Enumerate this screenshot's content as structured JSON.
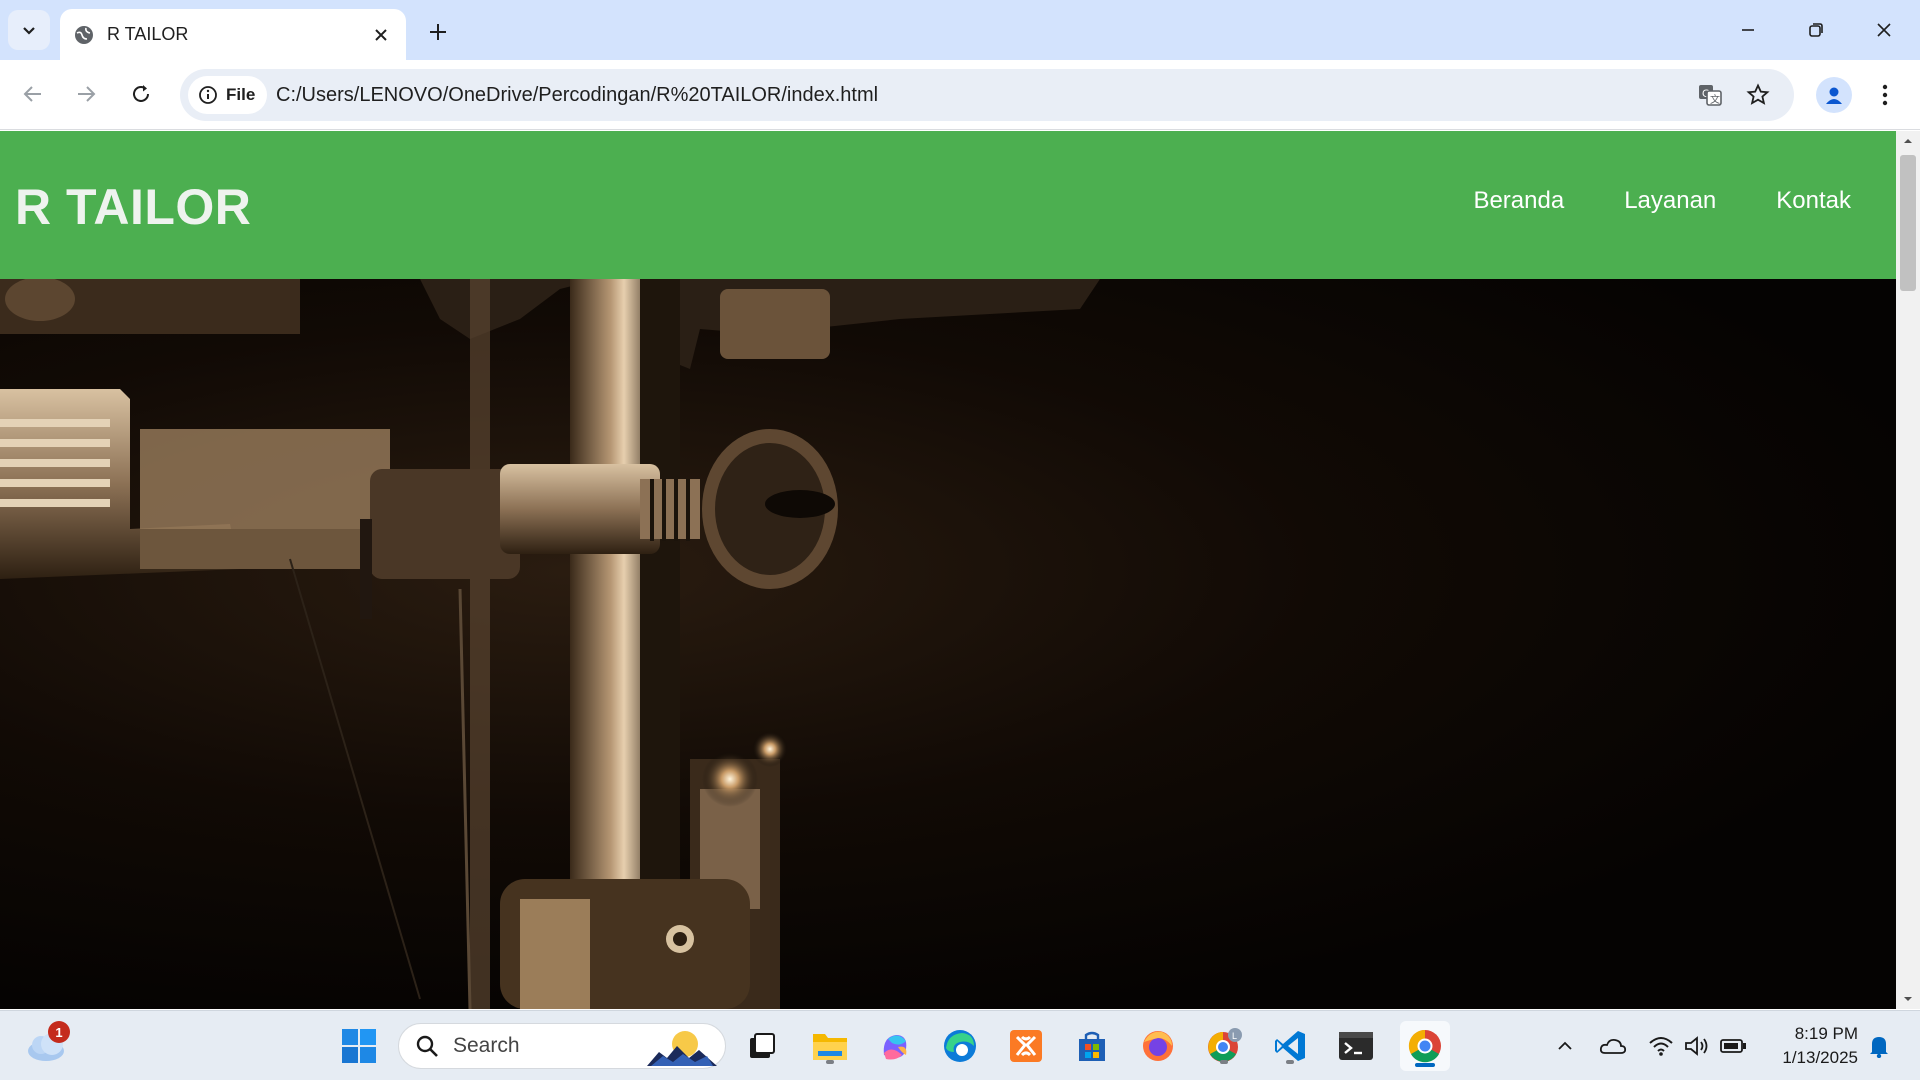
{
  "browser": {
    "tab_title": "R TAILOR",
    "chip_label": "File",
    "url": "C:/Users/LENOVO/OneDrive/Percodingan/R%20TAILOR/index.html"
  },
  "site": {
    "logo": "R TAILOR",
    "nav": [
      "Beranda",
      "Layanan",
      "Kontak"
    ],
    "header_color": "#4caf50"
  },
  "taskbar": {
    "search_label": "Search",
    "notification_count": "1",
    "time": "8:19 PM",
    "date": "1/13/2025",
    "apps": [
      "start-icon",
      "search",
      "task-view-icon",
      "file-explorer-icon",
      "copilot-icon",
      "edge-icon",
      "xampp-icon",
      "microsoft-store-icon",
      "firefox-icon",
      "chrome-profile-icon",
      "vscode-icon",
      "terminal-icon",
      "chrome-icon"
    ]
  }
}
